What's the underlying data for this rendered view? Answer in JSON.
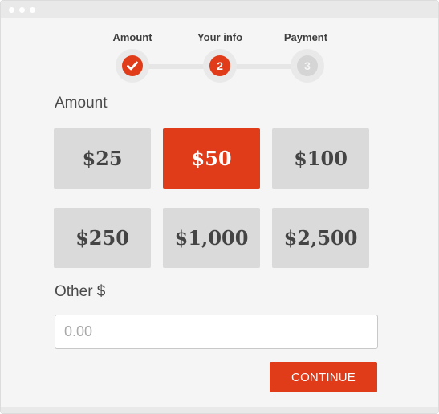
{
  "steps": [
    {
      "label": "Amount",
      "marker": "check-icon",
      "state": "complete"
    },
    {
      "label": "Your info",
      "marker": "2",
      "state": "active"
    },
    {
      "label": "Payment",
      "marker": "3",
      "state": "pending"
    }
  ],
  "amount_section": {
    "label": "Amount",
    "options": [
      "$25",
      "$50",
      "$100",
      "$250",
      "$1,000",
      "$2,500"
    ],
    "selected": "$50"
  },
  "other": {
    "label": "Other $",
    "placeholder": "0.00",
    "value": ""
  },
  "continue_label": "CONTINUE",
  "colors": {
    "accent": "#e03c1a",
    "button_bg": "#dadada",
    "page_bg": "#f5f5f5",
    "inactive_step": "#d5d5d5"
  }
}
